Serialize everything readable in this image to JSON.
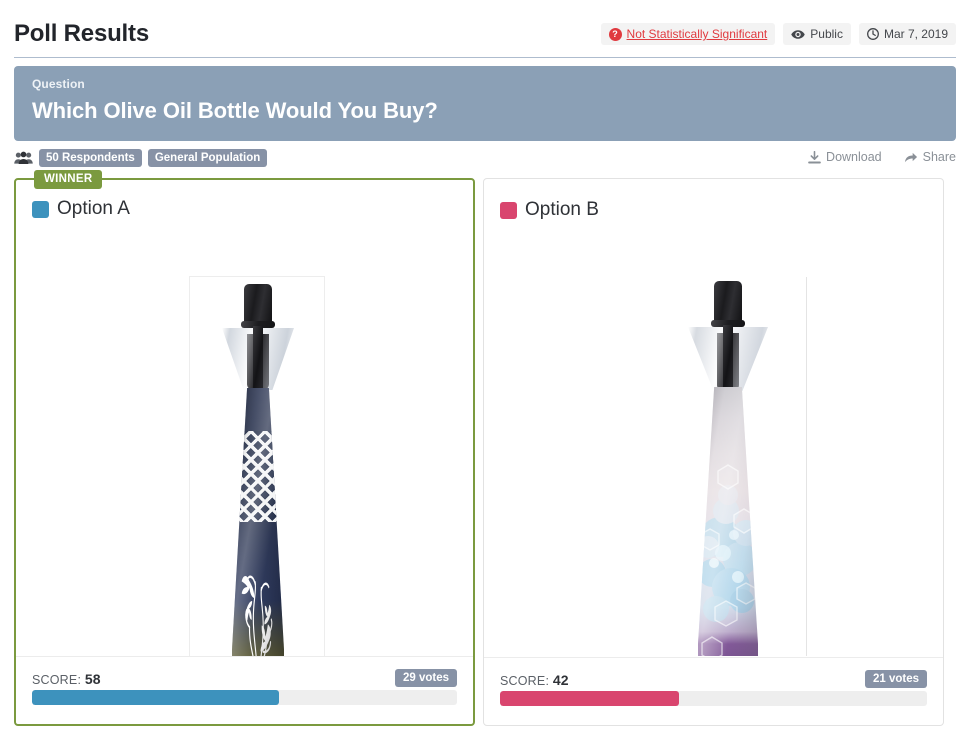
{
  "header": {
    "title": "Poll Results",
    "significance": {
      "label": "Not Statistically Significant",
      "icon": "question-mark-circle-icon",
      "color": "#e03a3f"
    },
    "visibility": {
      "label": "Public",
      "icon": "eye-icon"
    },
    "date": {
      "label": "Mar 7, 2019",
      "icon": "clock-icon"
    }
  },
  "question": {
    "label": "Question",
    "text": "Which Olive Oil Bottle Would You Buy?",
    "background": "#8ba0b6"
  },
  "meta": {
    "respondents_badge": "50 Respondents",
    "audience_badge": "General Population",
    "users_icon": "users-icon",
    "download": {
      "label": "Download",
      "icon": "download-icon"
    },
    "share": {
      "label": "Share",
      "icon": "share-arrow-icon"
    }
  },
  "options": [
    {
      "name": "Option A",
      "swatch_color": "#3d92bd",
      "winner": true,
      "winner_label": "WINNER",
      "winner_color": "#7b9a3f",
      "score_label": "SCORE:",
      "score": "58",
      "votes": "29 votes",
      "bar_percent": 58,
      "bar_color": "#3d92bd",
      "image_alt": "navy patterned olive oil bottle"
    },
    {
      "name": "Option B",
      "swatch_color": "#d9456e",
      "winner": false,
      "score_label": "SCORE:",
      "score": "42",
      "votes": "21 votes",
      "bar_percent": 42,
      "bar_color": "#d9456e",
      "image_alt": "frosted bokeh olive oil bottle"
    }
  ],
  "chart_data": {
    "type": "bar",
    "title": "Which Olive Oil Bottle Would You Buy?",
    "categories": [
      "Option A",
      "Option B"
    ],
    "values": [
      58,
      42
    ],
    "value_unit": "score",
    "votes": [
      29,
      21
    ],
    "total_respondents": 50,
    "ylabel": "Score",
    "xlabel": "",
    "ylim": [
      0,
      100
    ],
    "colors": [
      "#3d92bd",
      "#d9456e"
    ],
    "legend": [
      "Option A",
      "Option B"
    ],
    "grid": false
  }
}
